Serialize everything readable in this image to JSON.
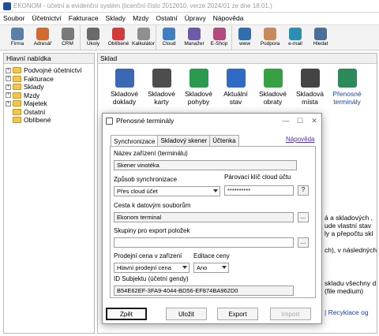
{
  "app": {
    "title": "EKONOM - účetní a evidenční systém (licenční číslo 2012010, verze 2024/01 ze dne 18.01.)"
  },
  "menu": [
    "Soubor",
    "Účetnictví",
    "Fakturace",
    "Sklady",
    "Mzdy",
    "Ostatní",
    "Úpravy",
    "Nápověda"
  ],
  "toolbar": [
    {
      "label": "Firma",
      "icon": "firma-icon",
      "color": "#5a7fa8"
    },
    {
      "label": "Adresář",
      "icon": "adresar-icon",
      "color": "#d06a2e"
    },
    {
      "label": "CRM",
      "icon": "crm-icon",
      "color": "#7a7a7a"
    },
    {
      "label": "Úkoly",
      "icon": "ukoly-icon",
      "color": "#6a6a6a"
    },
    {
      "label": "Oblíbené",
      "icon": "heart-icon",
      "color": "#d33b3b"
    },
    {
      "label": "Kalkulátor",
      "icon": "calculator-icon",
      "color": "#8f8f8f"
    },
    {
      "label": "Cloud",
      "icon": "cloud-icon",
      "color": "#3e7fc2"
    },
    {
      "label": "Manažer",
      "icon": "chart-icon",
      "color": "#6e5aa8"
    },
    {
      "label": "E-Shop",
      "icon": "cart-icon",
      "color": "#b34a7c"
    },
    {
      "label": "www",
      "icon": "globe-icon",
      "color": "#2f6fb0"
    },
    {
      "label": "Podpora",
      "icon": "support-icon",
      "color": "#c98a5b"
    },
    {
      "label": "e-mail",
      "icon": "email-icon",
      "color": "#2a8fb0"
    },
    {
      "label": "Hledat",
      "icon": "search-icon",
      "color": "#4a6f9a"
    }
  ],
  "left_panel": {
    "header": "Hlavní nabídka",
    "items": [
      {
        "label": "Podvojné účetnictví",
        "expand": "+"
      },
      {
        "label": "Fakturace",
        "expand": "+"
      },
      {
        "label": "Sklady",
        "expand": "+"
      },
      {
        "label": "Mzdy",
        "expand": "+"
      },
      {
        "label": "Majetek",
        "expand": "+"
      },
      {
        "label": "Ostatní",
        "expand": ""
      },
      {
        "label": "Oblíbené",
        "expand": ""
      }
    ]
  },
  "right_panel": {
    "header": "Sklad",
    "icons": [
      {
        "label": "Skladové doklady",
        "icon": "warehouse-docs-icon",
        "color": "#3b68b4"
      },
      {
        "label": "Skladové karty",
        "icon": "warehouse-cards-icon",
        "color": "#4d4d4d"
      },
      {
        "label": "Skladové pohyby",
        "icon": "warehouse-moves-icon",
        "color": "#2c9a4c"
      },
      {
        "label": "Aktuální stav",
        "icon": "sigma-icon",
        "color": "#2f6bc4"
      },
      {
        "label": "Skladové obraty",
        "icon": "turnover-icon",
        "color": "#36a043"
      },
      {
        "label": "Skladová místa",
        "icon": "locations-icon",
        "color": "#444444"
      },
      {
        "label": "Přenosné terminály",
        "icon": "terminal-icon",
        "color": "#2a8a5a"
      }
    ],
    "bg_text": [
      "á a skladových ,",
      "ude vlastní stav",
      "ly a přepočtu skl",
      "ch), v následných",
      "skladu všechny d",
      "(file medium)",
      "| Recyklace og"
    ]
  },
  "dialog": {
    "title": "Přenosné terminály",
    "tabs": [
      "Synchronizace",
      "Skladový skener",
      "Účtenka"
    ],
    "help_link": "Nápověda",
    "fields": {
      "device_name_label": "Název zařízení (terminálu)",
      "device_name": "Skener vinotéka",
      "sync_mode_label": "Způsob synchronizace",
      "sync_mode": "Přes cloud účet",
      "pair_key_label": "Párovací klíč cloud účtu",
      "pair_key": "**********",
      "question": "?",
      "data_path_label": "Cesta k datovým souborům",
      "data_path": "Ekonom terminal",
      "export_groups_label": "Skupiny pro export položek",
      "export_groups": "",
      "sell_price_label": "Prodejní cena v zařízení",
      "sell_price": "Hlavní prodejní cena",
      "edit_price_label": "Editace ceny",
      "edit_price": "Ano",
      "subject_id_label": "ID Subjektu (účetní gendy)",
      "subject_id": "B54E62EF-3FA9-4044-BD56-EF874BA962D0",
      "dots": "..."
    },
    "buttons": {
      "cancel": "Zpět",
      "save": "Uložit",
      "export": "Export",
      "import": "Import"
    }
  }
}
